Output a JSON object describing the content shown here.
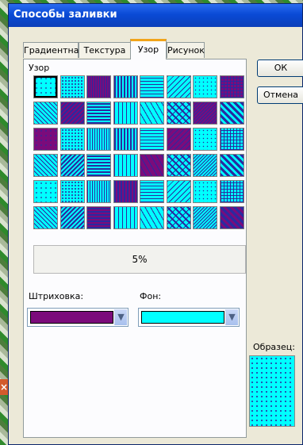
{
  "window": {
    "title": "Способы заливки"
  },
  "tabs": [
    {
      "label": "Градиентная"
    },
    {
      "label": "Текстура"
    },
    {
      "label": "Узор"
    },
    {
      "label": "Рисунок"
    }
  ],
  "active_tab": 2,
  "pattern_section": {
    "label": "Узор"
  },
  "selected_pattern": {
    "name": "5%"
  },
  "foreground": {
    "label": "Штриховка:",
    "color": "#7b0b7b"
  },
  "background": {
    "label": "Фон:",
    "color": "#00ffff"
  },
  "buttons": {
    "ok": "ОК",
    "cancel": "Отмена"
  },
  "sample": {
    "label": "Образец:"
  },
  "colors": {
    "pattern_fg": "#2a2aa0",
    "pattern_bg": "#00ffff",
    "title_bar": "#0a4ad6",
    "tab_highlight": "#f1a41a"
  },
  "close_glyph": "×"
}
